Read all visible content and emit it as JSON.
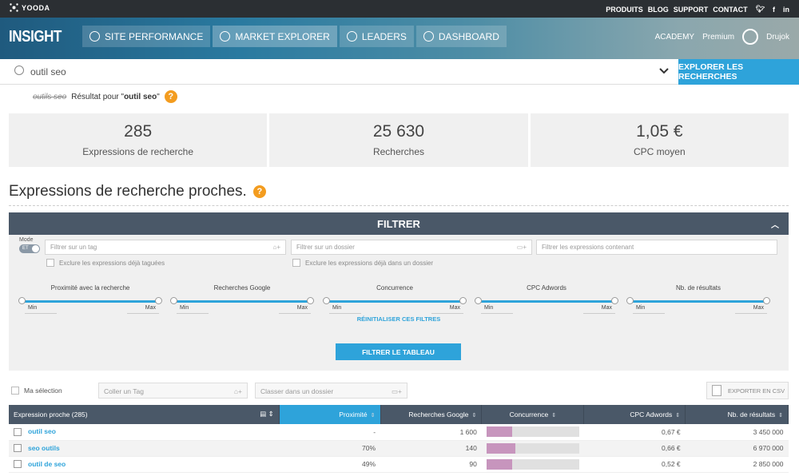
{
  "topbar": {
    "logo": "YOODA",
    "links": [
      "PRODUITS",
      "BLOG",
      "SUPPORT",
      "CONTACT"
    ],
    "social_icons": [
      "twitter-icon",
      "facebook-icon",
      "linkedin-icon"
    ]
  },
  "header": {
    "brand": "INSIGHT",
    "nav": [
      {
        "label": "SITE PERFORMANCE",
        "icon": "chart-icon"
      },
      {
        "label": "MARKET EXPLORER",
        "icon": "search-icon"
      },
      {
        "label": "LEADERS",
        "icon": "leaders-icon"
      },
      {
        "label": "DASHBOARD",
        "icon": "dashboard-icon"
      }
    ],
    "academy": "ACADEMY",
    "plan": "Premium",
    "user": "Drujok"
  },
  "search": {
    "value": "outil seo",
    "button": "EXPLORER LES RECHERCHES"
  },
  "correction": {
    "struck": "outils seo",
    "prefix": "Résultat pour \"",
    "query": "outil seo",
    "suffix": "\""
  },
  "stats": [
    {
      "value": "285",
      "label": "Expressions de recherche"
    },
    {
      "value": "25 630",
      "label": "Recherches"
    },
    {
      "value": "1,05 €",
      "label": "CPC moyen"
    }
  ],
  "section_title": "Expressions de recherche proches.",
  "filter": {
    "title": "FILTRER",
    "mode_label": "Mode",
    "mode_value": "ET",
    "tag_placeholder": "Filtrer sur un tag",
    "folder_placeholder": "Filtrer sur un dossier",
    "contains_placeholder": "Filtrer les expressions contenant",
    "exclude_tagged": "Exclure les expressions déjà taguées",
    "exclude_folder": "Exclure les expressions déjà dans un dossier",
    "sliders": [
      "Proximité avec la recherche",
      "Recherches Google",
      "Concurrence",
      "CPC Adwords",
      "Nb. de résultats"
    ],
    "min": "Min",
    "max": "Max",
    "reset": "RÉINITIALISER CES FILTRES",
    "apply": "FILTRER LE TABLEAU"
  },
  "toolbar": {
    "selection": "Ma sélection",
    "tag_placeholder": "Coller un Tag",
    "folder_placeholder": "Classer dans un dossier",
    "csv": "EXPORTER EN CSV"
  },
  "table": {
    "headers": [
      "Expression proche (285)",
      "Proximité",
      "Recherches Google",
      "Concurrence",
      "CPC Adwords",
      "Nb. de résultats"
    ],
    "rows": [
      {
        "kw": "outil seo",
        "prox": "-",
        "searches": "1 600",
        "competition": 0.28,
        "cpc": "0,67 €",
        "results": "3 450 000"
      },
      {
        "kw": "seo outils",
        "prox": "70%",
        "searches": "140",
        "competition": 0.31,
        "cpc": "0,66 €",
        "results": "6 970 000"
      },
      {
        "kw": "outil de seo",
        "prox": "49%",
        "searches": "90",
        "competition": 0.28,
        "cpc": "0,52 €",
        "results": "2 850 000"
      }
    ]
  },
  "colors": {
    "accent": "#2ea3da",
    "header_dark": "#4a5868",
    "help": "#f39c1f",
    "bar": "#c795bd"
  }
}
